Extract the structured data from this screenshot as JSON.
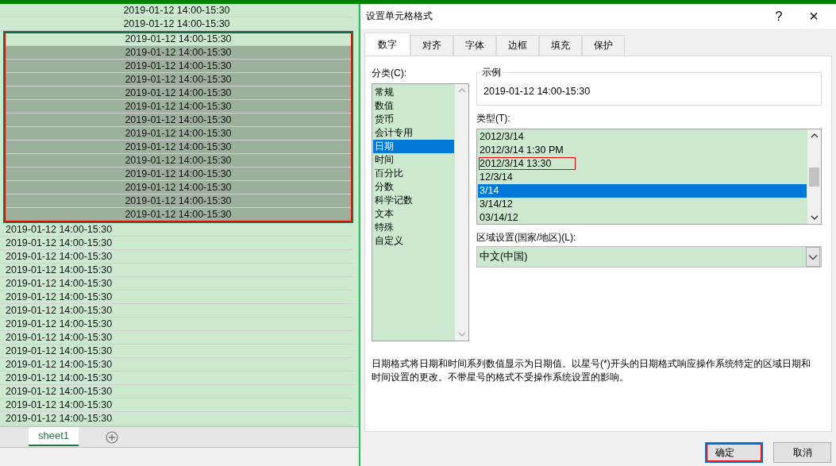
{
  "sheet": {
    "rows": [
      {
        "text": "2019-01-12 14:00-15:30",
        "kind": "center",
        "selected": false,
        "active": false
      },
      {
        "text": "2019-01-12 14:00-15:30",
        "kind": "center",
        "selected": false,
        "active": false
      },
      {
        "text": "2019-01-12 14:00-15:30",
        "kind": "center",
        "selected": true,
        "active": true
      },
      {
        "text": "2019-01-12 14:00-15:30",
        "kind": "center",
        "selected": true,
        "active": false
      },
      {
        "text": "2019-01-12 14:00-15:30",
        "kind": "center",
        "selected": true,
        "active": false
      },
      {
        "text": "2019-01-12 14:00-15:30",
        "kind": "center",
        "selected": true,
        "active": false
      },
      {
        "text": "2019-01-12 14:00-15:30",
        "kind": "center",
        "selected": true,
        "active": false
      },
      {
        "text": "2019-01-12 14:00-15:30",
        "kind": "center",
        "selected": true,
        "active": false
      },
      {
        "text": "2019-01-12 14:00-15:30",
        "kind": "center",
        "selected": true,
        "active": false
      },
      {
        "text": "2019-01-12 14:00-15:30",
        "kind": "center",
        "selected": true,
        "active": false
      },
      {
        "text": "2019-01-12 14:00-15:30",
        "kind": "center",
        "selected": true,
        "active": false
      },
      {
        "text": "2019-01-12 14:00-15:30",
        "kind": "center",
        "selected": true,
        "active": false
      },
      {
        "text": "2019-01-12 14:00-15:30",
        "kind": "center",
        "selected": true,
        "active": false
      },
      {
        "text": "2019-01-12 14:00-15:30",
        "kind": "center",
        "selected": true,
        "active": false
      },
      {
        "text": "2019-01-12 14:00-15:30",
        "kind": "center",
        "selected": true,
        "active": false
      },
      {
        "text": "2019-01-12 14:00-15:30",
        "kind": "center",
        "selected": true,
        "active": false
      },
      {
        "text": "2019-01-12 14:00-15:30",
        "kind": "left",
        "selected": false,
        "active": false
      },
      {
        "text": "2019-01-12 14:00-15:30",
        "kind": "left",
        "selected": false,
        "active": false
      },
      {
        "text": "2019-01-12 14:00-15:30",
        "kind": "left",
        "selected": false,
        "active": false
      },
      {
        "text": "2019-01-12 14:00-15:30",
        "kind": "left",
        "selected": false,
        "active": false
      },
      {
        "text": "2019-01-12 14:00-15:30",
        "kind": "left",
        "selected": false,
        "active": false
      },
      {
        "text": "2019-01-12 14:00-15:30",
        "kind": "left",
        "selected": false,
        "active": false
      },
      {
        "text": "2019-01-12 14:00-15:30",
        "kind": "left",
        "selected": false,
        "active": false
      },
      {
        "text": "2019-01-12 14:00-15:30",
        "kind": "left",
        "selected": false,
        "active": false
      },
      {
        "text": "2019-01-12 14:00-15:30",
        "kind": "left",
        "selected": false,
        "active": false
      },
      {
        "text": "2019-01-12 14:00-15:30",
        "kind": "left",
        "selected": false,
        "active": false
      },
      {
        "text": "2019-01-12 14:00-15:30",
        "kind": "left",
        "selected": false,
        "active": false
      },
      {
        "text": "2019-01-12 14:00-15:30",
        "kind": "left",
        "selected": false,
        "active": false
      },
      {
        "text": "2019-01-12 14:00-15:30",
        "kind": "left",
        "selected": false,
        "active": false
      },
      {
        "text": "2019-01-12 14:00-15:30",
        "kind": "left",
        "selected": false,
        "active": false
      },
      {
        "text": "2019-01-12 14:00-15:30",
        "kind": "left",
        "selected": false,
        "active": false
      }
    ],
    "sheet_tabs": [
      {
        "label": "sheet1",
        "selected": true
      }
    ]
  },
  "dialog": {
    "title": "设置单元格格式",
    "help": "?",
    "close": "×",
    "tabs": [
      {
        "label": "数字",
        "selected": true
      },
      {
        "label": "对齐",
        "selected": false
      },
      {
        "label": "字体",
        "selected": false
      },
      {
        "label": "边框",
        "selected": false
      },
      {
        "label": "填充",
        "selected": false
      },
      {
        "label": "保护",
        "selected": false
      }
    ],
    "category_label": "分类(C):",
    "categories": [
      {
        "label": "常规",
        "selected": false
      },
      {
        "label": "数值",
        "selected": false
      },
      {
        "label": "货币",
        "selected": false
      },
      {
        "label": "会计专用",
        "selected": false
      },
      {
        "label": "日期",
        "selected": true
      },
      {
        "label": "时间",
        "selected": false
      },
      {
        "label": "百分比",
        "selected": false
      },
      {
        "label": "分数",
        "selected": false
      },
      {
        "label": "科学记数",
        "selected": false
      },
      {
        "label": "文本",
        "selected": false
      },
      {
        "label": "特殊",
        "selected": false
      },
      {
        "label": "自定义",
        "selected": false
      }
    ],
    "sample": {
      "legend": "示例",
      "value": "2019-01-12 14:00-15:30"
    },
    "type_label": "类型(T):",
    "types": [
      {
        "label": "2012/3/14",
        "selected": false,
        "annotated": false
      },
      {
        "label": "2012/3/14 1:30 PM",
        "selected": false,
        "annotated": false
      },
      {
        "label": "2012/3/14 13:30",
        "selected": false,
        "annotated": true
      },
      {
        "label": "12/3/14",
        "selected": false,
        "annotated": false
      },
      {
        "label": "3/14",
        "selected": true,
        "annotated": false
      },
      {
        "label": "3/14/12",
        "selected": false,
        "annotated": false
      },
      {
        "label": "03/14/12",
        "selected": false,
        "annotated": false
      }
    ],
    "locale_label": "区域设置(国家/地区)(L):",
    "locale": {
      "value": "中文(中国)"
    },
    "description": "日期格式将日期和时间系列数值显示为日期值。以星号(*)开头的日期格式响应操作系统特定的区域日期和时间设置的更改。不带星号的格式不受操作系统设置的影响。",
    "buttons": [
      {
        "label": "确定",
        "default": true,
        "annotated": true
      },
      {
        "label": "取消",
        "default": false,
        "annotated": false
      }
    ]
  }
}
